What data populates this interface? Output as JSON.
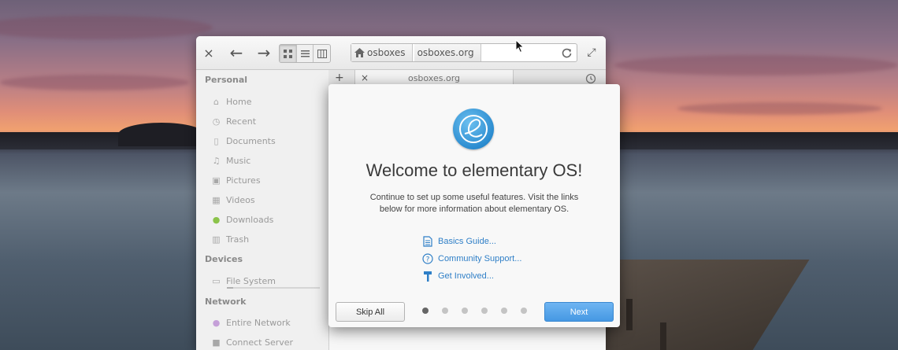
{
  "file_manager": {
    "close_label": "×",
    "back_label": "←",
    "forward_label": "→",
    "maximize_label": "⤢",
    "breadcrumbs": [
      "osboxes",
      "osboxes.org"
    ],
    "new_tab_label": "+",
    "tab_close_label": "×",
    "tab_title": "osboxes.org",
    "sidebar": {
      "sections": [
        {
          "title": "Personal",
          "items": [
            {
              "label": "Home",
              "icon": "home-icon"
            },
            {
              "label": "Recent",
              "icon": "recent-icon"
            },
            {
              "label": "Documents",
              "icon": "documents-icon"
            },
            {
              "label": "Music",
              "icon": "music-icon"
            },
            {
              "label": "Pictures",
              "icon": "pictures-icon"
            },
            {
              "label": "Videos",
              "icon": "videos-icon"
            },
            {
              "label": "Downloads",
              "icon": "downloads-icon"
            },
            {
              "label": "Trash",
              "icon": "trash-icon"
            }
          ]
        },
        {
          "title": "Devices",
          "items": [
            {
              "label": "File System",
              "icon": "drive-icon"
            }
          ]
        },
        {
          "title": "Network",
          "items": [
            {
              "label": "Entire Network",
              "icon": "network-icon"
            },
            {
              "label": "Connect Server",
              "icon": "server-icon"
            }
          ]
        }
      ]
    }
  },
  "dialog": {
    "title": "Welcome to elementary OS!",
    "body": "Continue to set up some useful features. Visit the links below for more information about elementary OS.",
    "links": [
      {
        "label": "Basics Guide...",
        "icon": "document-icon"
      },
      {
        "label": "Community Support...",
        "icon": "help-icon"
      },
      {
        "label": "Get Involved...",
        "icon": "hammer-icon"
      }
    ],
    "skip_label": "Skip All",
    "next_label": "Next",
    "pages_total": 6,
    "current_page": 1
  },
  "colors": {
    "accent": "#4598e3",
    "link": "#2f7fc7"
  }
}
